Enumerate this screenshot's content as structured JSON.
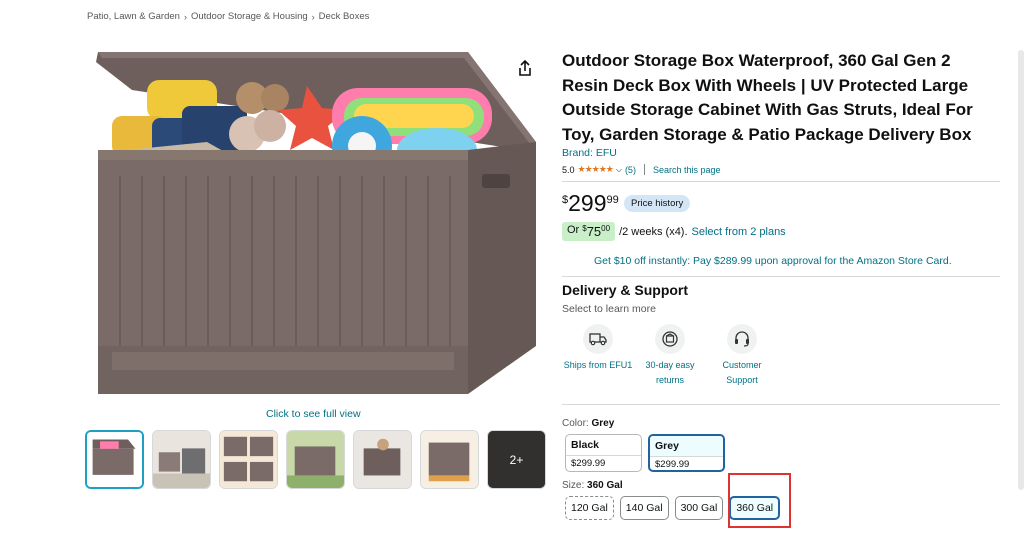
{
  "breadcrumb": [
    "Patio, Lawn & Garden",
    "Outdoor Storage & Housing",
    "Deck Boxes"
  ],
  "product": {
    "title": "Outdoor Storage Box Waterproof, 360 Gal Gen 2 Resin Deck Box With Wheels | UV Protected Large Outside Storage Cabinet With Gas Struts, Ideal For Toy, Garden Storage & Patio Package Delivery Box",
    "brand": "Brand: EFU",
    "rating": "5.0",
    "stars": "★★★★★",
    "review_count": "(5)",
    "search_page": "Search this page"
  },
  "price": {
    "symbol": "$",
    "whole": "299",
    "fraction": "99",
    "history_label": "Price history"
  },
  "installment": {
    "or": "Or",
    "symbol": "$",
    "amount": "75",
    "fraction": "00",
    "terms": "/2 weeks (x4).",
    "plans_link": "Select from 2 plans"
  },
  "promo": "Get $10 off instantly: Pay $289.99 upon approval for the Amazon Store Card.",
  "delivery": {
    "title": "Delivery & Support",
    "subtitle": "Select to learn more",
    "items": [
      {
        "icon": "truck-icon",
        "label": "Ships from EFU1"
      },
      {
        "icon": "return-box-icon",
        "label": "30-day easy returns"
      },
      {
        "icon": "headset-icon",
        "label": "Customer Support"
      }
    ]
  },
  "gallery": {
    "full_view": "Click to see full view",
    "more_label": "2+"
  },
  "color": {
    "label": "Color:",
    "selected": "Grey",
    "options": [
      {
        "name": "Black",
        "price": "$299.99"
      },
      {
        "name": "Grey",
        "price": "$299.99"
      }
    ]
  },
  "size": {
    "label": "Size:",
    "selected": "360 Gal",
    "options": [
      "120 Gal",
      "140 Gal",
      "300 Gal",
      "360 Gal"
    ]
  },
  "colors": {
    "link": "#007185",
    "star": "#de7921",
    "selected_border": "#2162a1",
    "highlight": "#e0322f",
    "box_brown": "#7a6b68"
  }
}
